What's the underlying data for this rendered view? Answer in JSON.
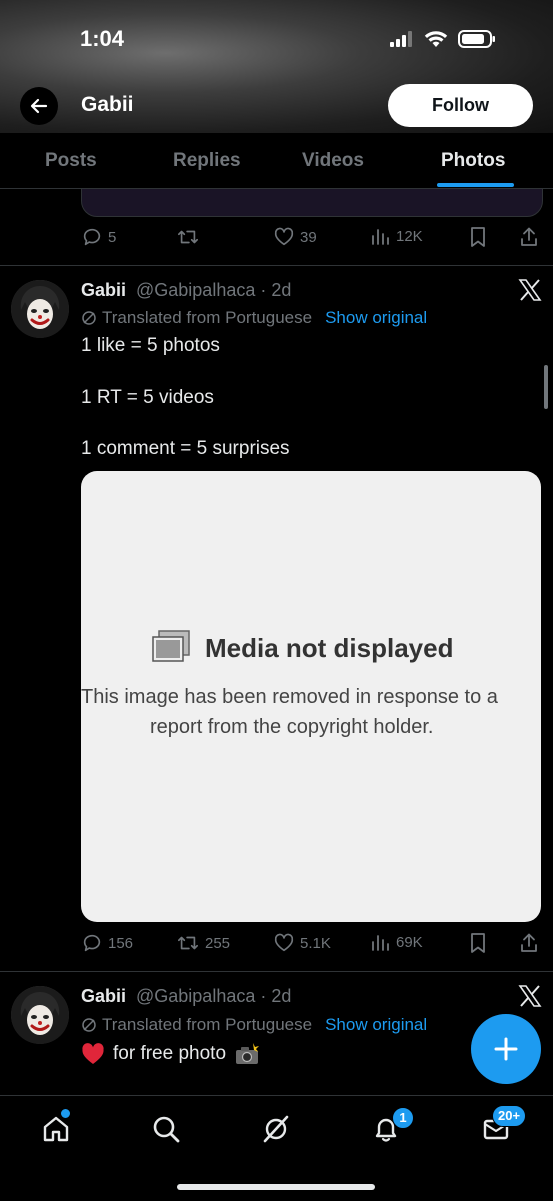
{
  "status_bar": {
    "time": "1:04"
  },
  "header": {
    "name": "Gabii",
    "follow_label": "Follow"
  },
  "tabs": [
    {
      "label": "Posts"
    },
    {
      "label": "Replies"
    },
    {
      "label": "Videos"
    },
    {
      "label": "Photos",
      "active": true
    }
  ],
  "tweet_prev": {
    "stats": {
      "replies": "5",
      "reposts": "",
      "likes": "39",
      "views": "12K"
    }
  },
  "tweet_1": {
    "name": "Gabii",
    "handle": "@Gabipalhaca",
    "age": "2d",
    "translated": "Translated from Portuguese",
    "show_original": "Show original",
    "lines": [
      "1 like = 5 photos",
      "1 RT = 5 videos",
      "1 comment = 5 surprises"
    ],
    "media": {
      "title": "Media not displayed",
      "line1": "This image has been removed in response to a",
      "line2": "report from the copyright holder."
    },
    "stats": {
      "replies": "156",
      "reposts": "255",
      "likes": "5.1K",
      "views": "69K"
    }
  },
  "tweet_2": {
    "name": "Gabii",
    "handle": "@Gabipalhaca",
    "age": "2d",
    "translated": "Translated from Portuguese",
    "show_original": "Show original",
    "text": "for free photo"
  },
  "nav": {
    "notifications_badge": "1",
    "messages_badge": "20+"
  },
  "colors": {
    "accent": "#1d9bf0",
    "muted": "#71767b",
    "background": "#000000"
  }
}
